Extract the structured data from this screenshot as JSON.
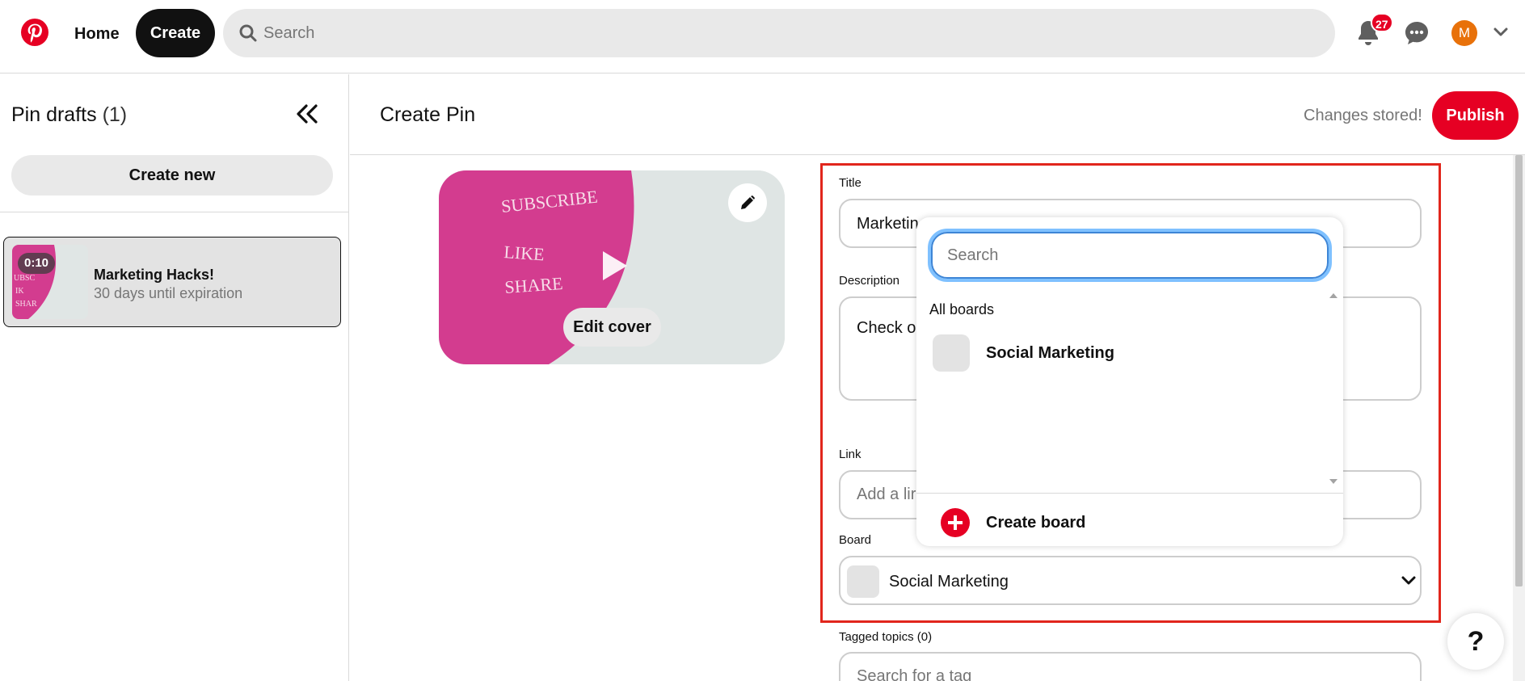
{
  "nav": {
    "home": "Home",
    "create": "Create",
    "search_placeholder": "Search",
    "notification_count": "27",
    "avatar_initial": "M",
    "brand_color": "#e60023"
  },
  "sidebar": {
    "title": "Pin drafts",
    "count": "(1)",
    "create_new": "Create new",
    "drafts": [
      {
        "name": "Marketing Hacks!",
        "expiry": "30 days until expiration",
        "duration": "0:10"
      }
    ]
  },
  "header": {
    "title": "Create Pin",
    "status": "Changes stored!",
    "publish": "Publish"
  },
  "media": {
    "lyrics": [
      "SUBSCRIBE",
      "LIKE",
      "SHARE"
    ],
    "edit_cover": "Edit cover",
    "thumb_words": [
      "UBSC",
      "IK",
      "SHAR"
    ]
  },
  "form": {
    "title_label": "Title",
    "title_value": "Marketin",
    "description_label": "Description",
    "description_value": "Check ou",
    "link_label": "Link",
    "link_placeholder": "Add a lir",
    "board_label": "Board",
    "board_value": "Social Marketing",
    "tagged_label": "Tagged topics (0)",
    "tag_placeholder": "Search for a tag"
  },
  "dropdown": {
    "search_placeholder": "Search",
    "section": "All boards",
    "boards": [
      "Social Marketing"
    ],
    "create_board": "Create board"
  },
  "help": "?"
}
